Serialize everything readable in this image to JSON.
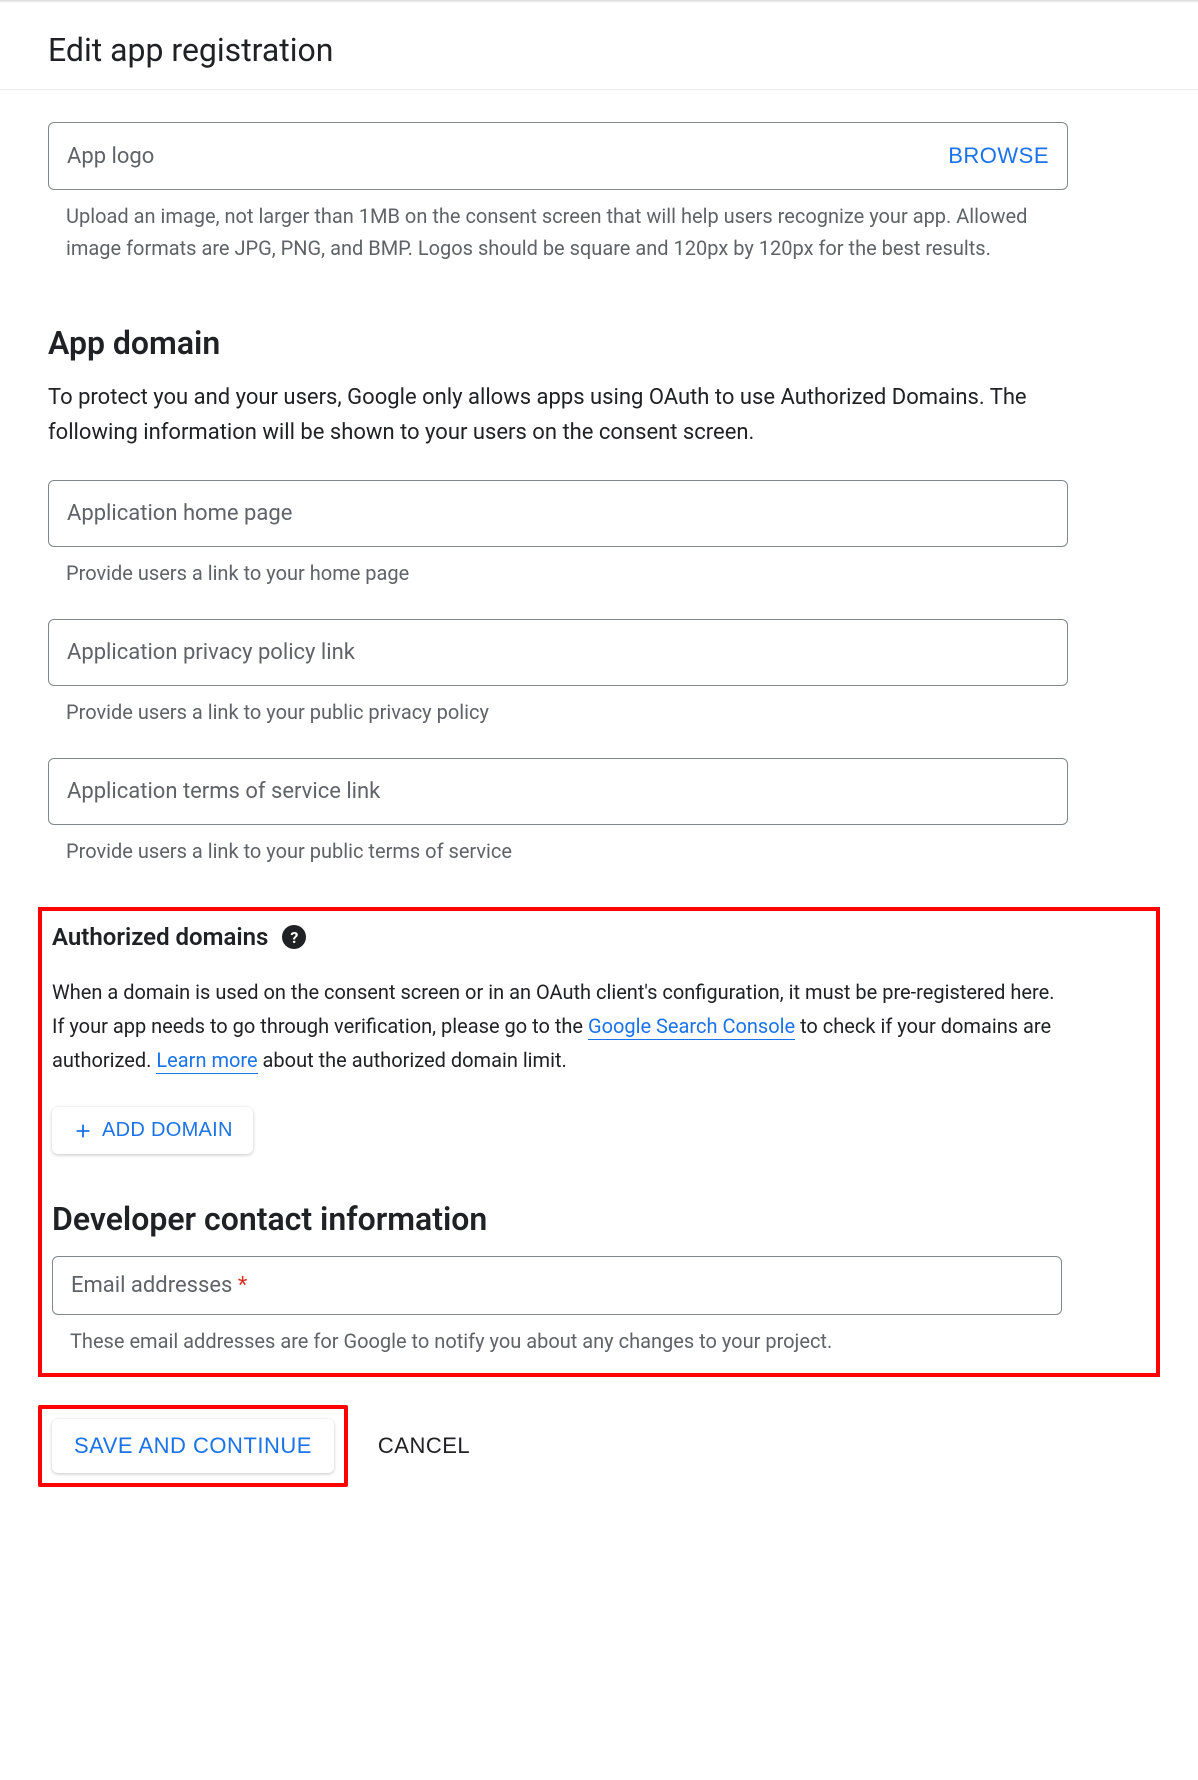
{
  "page": {
    "title": "Edit app registration"
  },
  "appLogo": {
    "placeholder": "App logo",
    "browseLabel": "BROWSE",
    "helper": "Upload an image, not larger than 1MB on the consent screen that will help users recognize your app. Allowed image formats are JPG, PNG, and BMP. Logos should be square and 120px by 120px for the best results."
  },
  "appDomain": {
    "title": "App domain",
    "desc": "To protect you and your users, Google only allows apps using OAuth to use Authorized Domains. The following information will be shown to your users on the consent screen.",
    "homePage": {
      "placeholder": "Application home page",
      "helper": "Provide users a link to your home page"
    },
    "privacy": {
      "placeholder": "Application privacy policy link",
      "helper": "Provide users a link to your public privacy policy"
    },
    "tos": {
      "placeholder": "Application terms of service link",
      "helper": "Provide users a link to your public terms of service"
    }
  },
  "authorizedDomains": {
    "title": "Authorized domains",
    "descPart1": "When a domain is used on the consent screen or in an OAuth client's configuration, it must be pre-registered here. If your app needs to go through verification, please go to the ",
    "link1": "Google Search Console",
    "descPart2": " to check if your domains are authorized. ",
    "link2": "Learn more",
    "descPart3": " about the authorized domain limit.",
    "addDomainLabel": "ADD DOMAIN"
  },
  "developerContact": {
    "title": "Developer contact information",
    "emailPlaceholder": "Email addresses ",
    "helper": "These email addresses are for Google to notify you about any changes to your project."
  },
  "buttons": {
    "save": "SAVE AND CONTINUE",
    "cancel": "CANCEL"
  }
}
